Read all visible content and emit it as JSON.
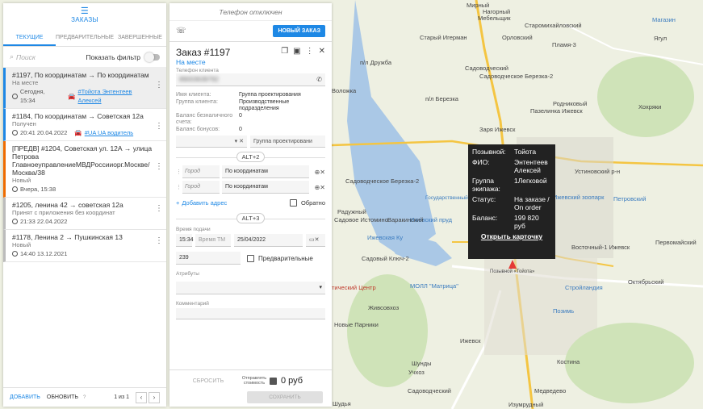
{
  "left_panel": {
    "header_title": "ЗАКАЗЫ",
    "tabs": [
      "ТЕКУЩИЕ",
      "ПРЕДВАРИТЕЛЬНЫЕ",
      "ЗАВЕРШЕННЫЕ"
    ],
    "search_placeholder": "Поиск",
    "filter_label": "Показать фильтр",
    "orders": [
      {
        "title": "#1197, По координатам → По координатам",
        "status": "На месте",
        "time": "Сегодня, 15:34",
        "driver": "#Тойота Энтентеев Алексей"
      },
      {
        "title": "#1184, По координатам → Советская 12а",
        "status": "Получен",
        "time": "20:41 20.04.2022",
        "driver": "#UA UA водитель"
      },
      {
        "title": "[ПРЕДВ] #1204, Советская ул. 12А → улица Петрова ГлавноеуправлениеМВДРоссииорг.Москве/ Москва/38",
        "status": "Новый",
        "time": "Вчера, 15:38"
      },
      {
        "title": "#1205, ленина 42 → советская 12а",
        "status": "Принят с приложения без координат",
        "time": "21:33 22.04.2022"
      },
      {
        "title": "#1178, Ленина 2 → Пушкинская 13",
        "status": "Новый",
        "time": "14:40 13.12.2021"
      }
    ],
    "footer": {
      "add": "ДОБАВИТЬ",
      "refresh": "ОБНОВИТЬ",
      "help": "?",
      "page": "1 из 1"
    }
  },
  "mid_panel": {
    "phone_status": "Телефон отключен",
    "new_order_button": "НОВЫЙ ЗАКАЗ",
    "order_number": "Заказ #1197",
    "order_state": "На месте",
    "phone_label": "Телефон клиента",
    "phone_value": "89003639792",
    "client_name_label": "Имя клиента:",
    "client_name_value": "Группа проектирования",
    "client_group_label": "Группа клиента:",
    "client_group_value": "Производственные подразделения",
    "cashless_label": "Баланс безналичного счета:",
    "cashless_value": "0",
    "bonus_label": "Баланс бонусов:",
    "bonus_value": "0",
    "group_select": "Группа проектировани",
    "alt1": "ALT+2",
    "city_placeholder": "Город",
    "address1": "По координатам",
    "address2": "По координатам",
    "add_address": "Добавить адрес",
    "back_label": "Обратно",
    "alt2": "ALT+3",
    "time_label": "Время подачи",
    "time_value": "15:34",
    "time_tm": "Время ТМ",
    "date_value": "25/04/2022",
    "field_value": "239",
    "preliminary_label": "Предварительные",
    "attributes_label": "Атрибуты",
    "comment_label": "Комментарий",
    "reset_button": "СБРОСИТЬ",
    "send_cost_label": "Отправлять стоимость",
    "price": "0 руб",
    "save_button": "СОХРАНИТЬ"
  },
  "popup": {
    "callsign_label": "Позывной:",
    "callsign_value": "Тойота",
    "fio_label": "ФИО:",
    "fio_value": "Энтентеев Алексей",
    "group_label": "Группа экипажа:",
    "group_value": "1Легковой",
    "status_label": "Статус:",
    "status_value": "На заказе / On order",
    "balance_label": "Баланс:",
    "balance_value": "199 820 руб",
    "open_card": "Открыть карточку"
  },
  "map_labels": {
    "l1": "Мирный",
    "l2": "Нагорный",
    "l3": "Мебельщик",
    "l4": "Старомихайловский",
    "l5": "Магазин",
    "l6": "Старый Игерман",
    "l7": "Орловский",
    "l8": "Пламя-3",
    "l9": "Ягул",
    "l10": "п/л Дружба",
    "l11": "Садоводческий",
    "l12": "Садоводческое Березка-2",
    "l13": "Воложка",
    "l14": "п/л Березка",
    "l15": "Родниковый",
    "l16": "Хохряки",
    "l17": "Заря Ижевск",
    "l18": "Пазелинка Ижевск",
    "l19": "Устиновский р-н",
    "l20": "Садоводческое Березка-2",
    "l21": "Радужный",
    "l22": "Ижевский пруд",
    "l23": "Варакинский",
    "l24": "Садовое Истомино",
    "l25": "Садовый Ключ-2",
    "l26": "Восточный-1 Ижевск",
    "l27": "Первомайский",
    "l28": "Октябрьский",
    "l29": "МОЛЛ \"Матрица\"",
    "l30": "Стройландия",
    "l31": "Позимь",
    "l32": "Живсовхоз",
    "l33": "Новые Парники",
    "l34": "Ижевск",
    "l35": "Шунды",
    "l36": "Учхоз",
    "l37": "Костина",
    "l38": "Медведево",
    "l39": "Садоводческий",
    "l40": "Изумрудный",
    "l41": "Шудья",
    "l42": "Ижевский зоопарк",
    "l43": "Петровский",
    "l44": "Позывной «Тойота»",
    "l45": "Государственный зоопарк",
    "l46": "Ижевская Ку",
    "l47": "тический Центр"
  }
}
